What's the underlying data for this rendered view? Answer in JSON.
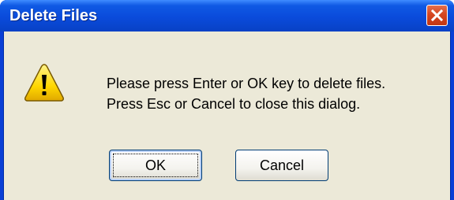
{
  "dialog": {
    "title": "Delete Files",
    "close_icon": "close-icon",
    "warning_icon": "warning-icon",
    "message_line1": "Please press Enter or OK key to delete files.",
    "message_line2": "Press Esc or Cancel to close this dialog.",
    "ok_label": "OK",
    "cancel_label": "Cancel"
  },
  "colors": {
    "titlebar": "#0a4bdb",
    "client_bg": "#ece9d8",
    "close_button": "#d64620",
    "warning_yellow": "#ffd700"
  }
}
